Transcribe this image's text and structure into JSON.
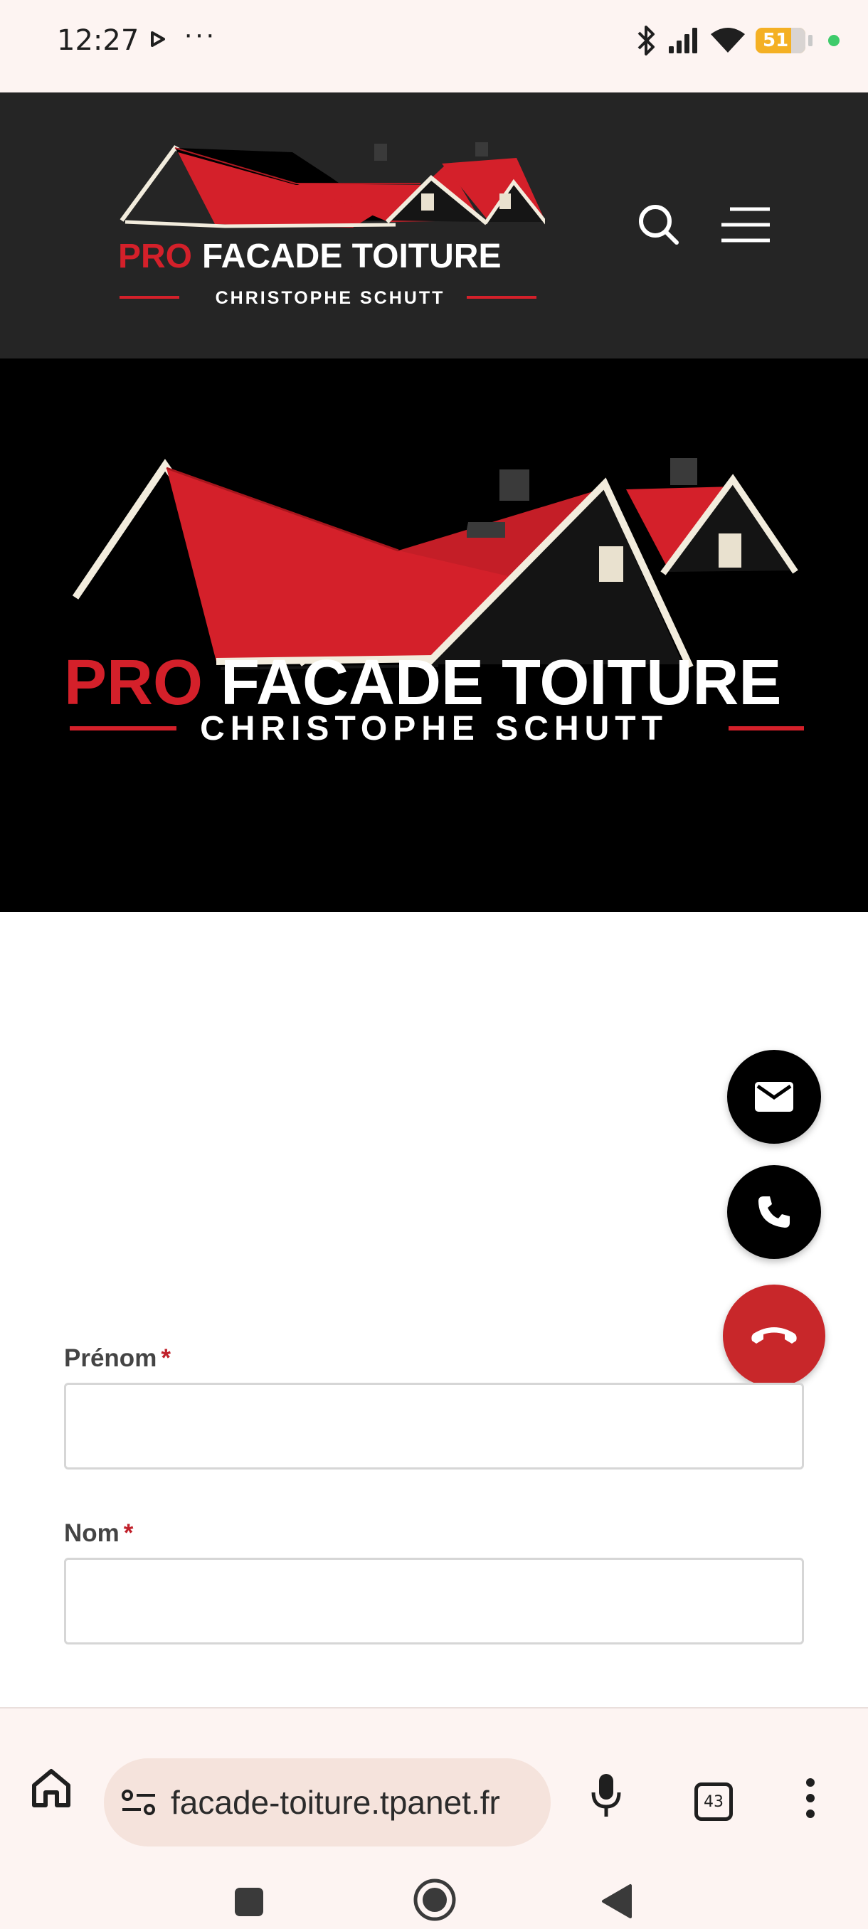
{
  "status_bar": {
    "time": "12:27",
    "dots": "···",
    "battery_level": "51",
    "icons": [
      "play-icon",
      "bluetooth-icon",
      "signal-icon",
      "wifi-icon",
      "battery-icon"
    ]
  },
  "header": {
    "logo": {
      "prefix": "PRO",
      "main": "FACADE TOITURE",
      "subtitle": "CHRISTOPHE  SCHUTT"
    },
    "icons": [
      "search-icon",
      "menu-icon"
    ]
  },
  "hero": {
    "logo": {
      "prefix": "PRO",
      "main": "FACADE TOITURE",
      "subtitle": "CHRISTOPHE  SCHUTT"
    }
  },
  "form": {
    "required_marker": "*",
    "fields": [
      {
        "label": "Prénom",
        "value": ""
      },
      {
        "label": "Nom",
        "value": ""
      }
    ]
  },
  "floating_buttons": [
    "mail-icon",
    "phone-icon",
    "hang-up-icon"
  ],
  "browser": {
    "url": "facade-toiture.tpanet.fr",
    "tab_count": "43",
    "icons": [
      "home-icon",
      "site-settings-icon",
      "mic-icon",
      "tabs-icon",
      "more-icon"
    ]
  },
  "system_nav": [
    "recents-icon",
    "home-circle-icon",
    "back-icon"
  ],
  "colors": {
    "brand_red": "#c8272a",
    "header_bg": "#252525",
    "hero_bg": "#000000",
    "status_bg": "#fdf4f2",
    "url_pill_bg": "#f5e3dc"
  }
}
